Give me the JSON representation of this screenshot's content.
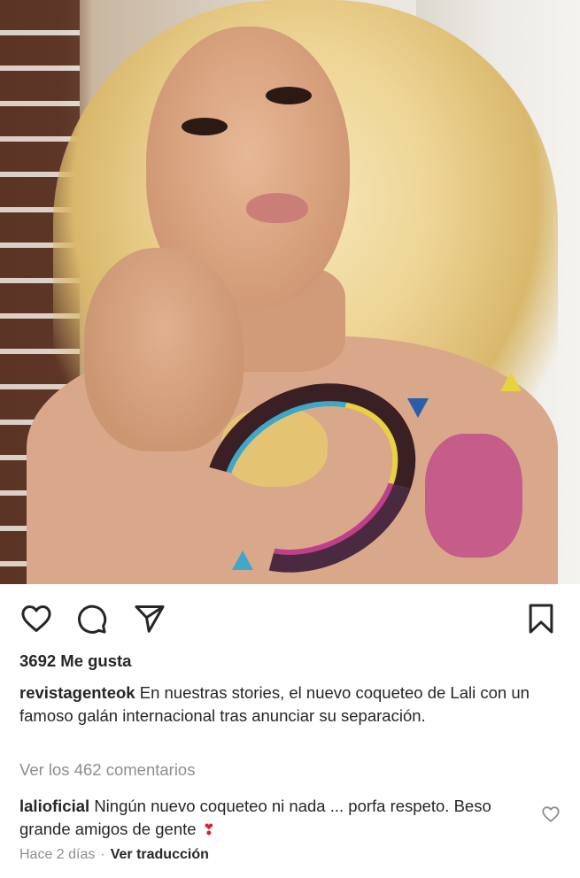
{
  "post": {
    "likes_text": "3692 Me gusta",
    "caption": {
      "username": "revistagenteok",
      "text": "En nuestras stories, el nuevo coqueteo de Lali con un famoso galán internacional tras anunciar su separación."
    },
    "view_comments_label": "Ver los 462 comentarios",
    "comment": {
      "username": "lalioficial",
      "text": "Ningún nuevo coqueteo ni nada ... porfa respeto. Beso grande amigos de gente",
      "emoji": "❣"
    },
    "timestamp": "Hace 2 días",
    "separator": "·",
    "translate_label": "Ver traducción"
  },
  "icons": {
    "like": "heart-outline-icon",
    "comment": "comment-bubble-icon",
    "share": "paper-plane-icon",
    "save": "bookmark-icon",
    "comment_like": "small-heart-icon"
  },
  "colors": {
    "text": "#262626",
    "secondary": "#8e8e8e",
    "emoji_red": "#d8242c"
  }
}
